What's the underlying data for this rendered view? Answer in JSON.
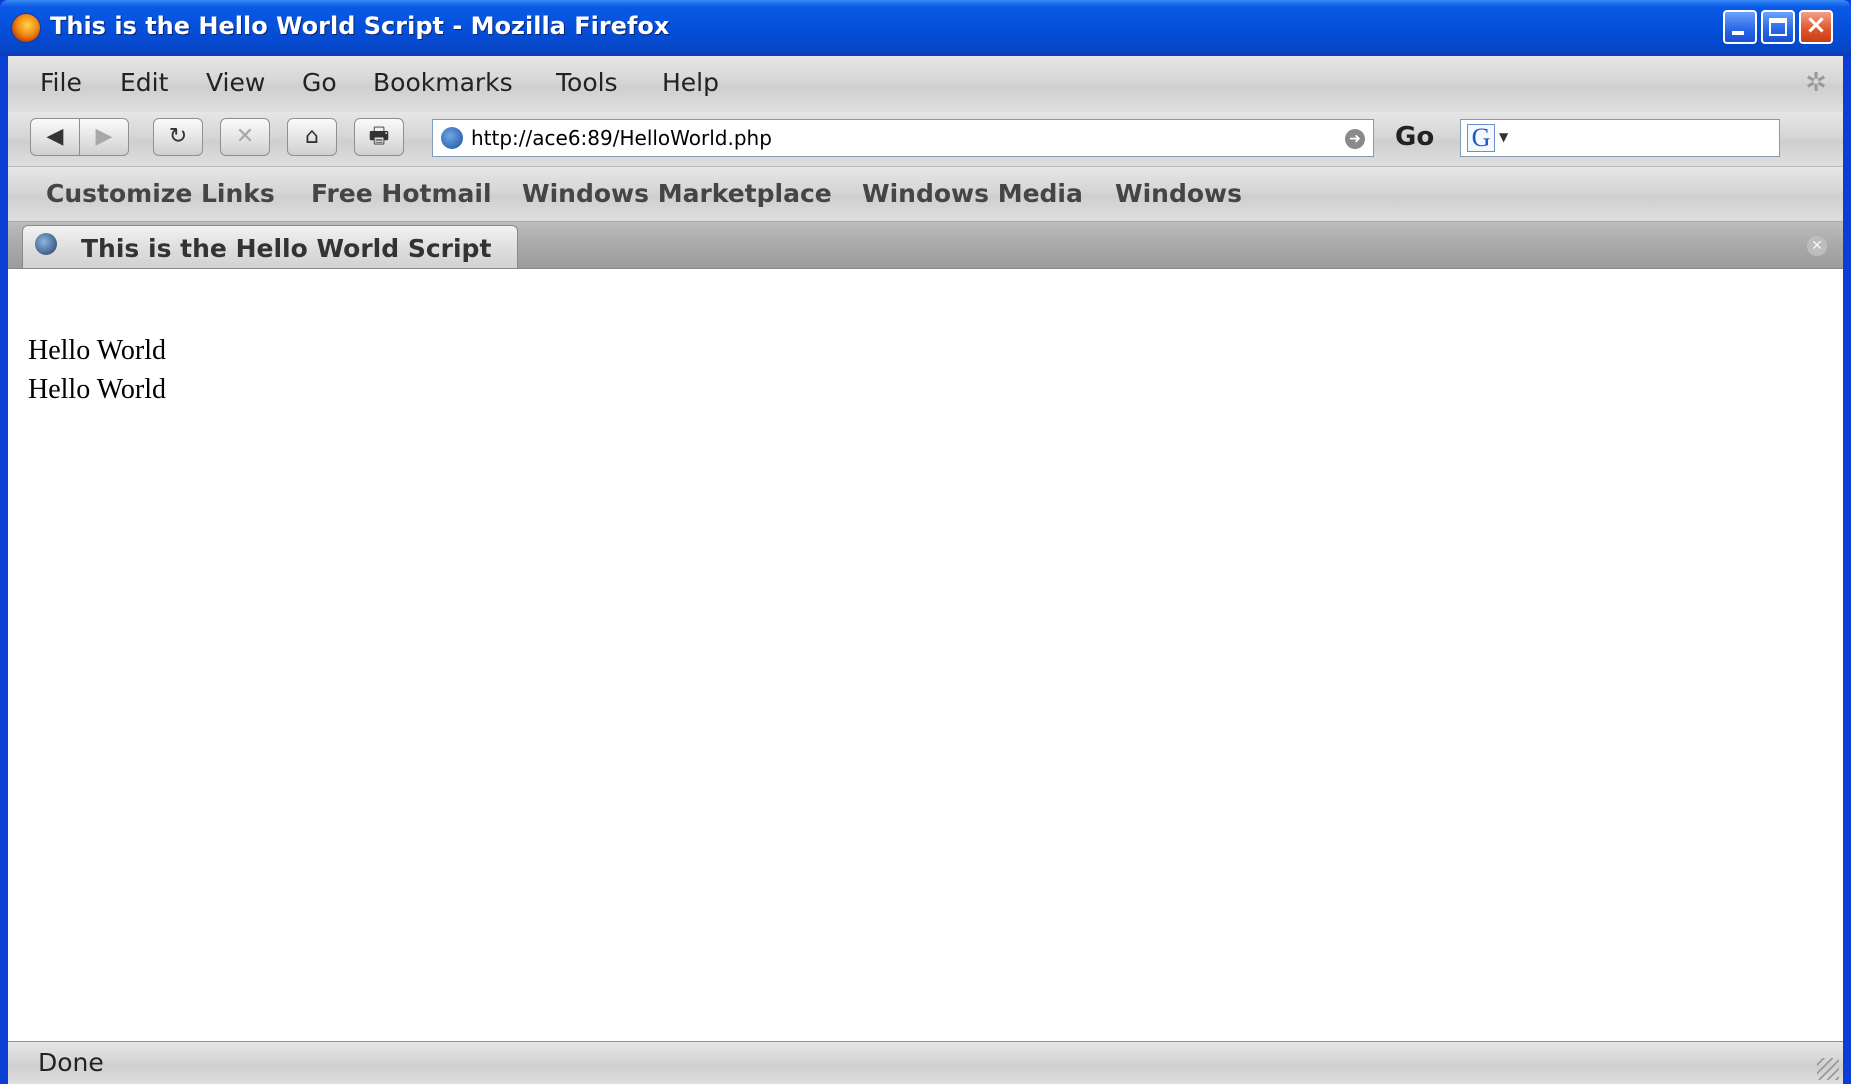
{
  "window": {
    "title": "This is the Hello World Script - Mozilla Firefox",
    "controls": [
      "minimize",
      "maximize",
      "close"
    ]
  },
  "menu": {
    "items": [
      "File",
      "Edit",
      "View",
      "Go",
      "Bookmarks",
      "Tools",
      "Help"
    ]
  },
  "toolbar": {
    "back_icon": "◀",
    "forward_icon": "▶",
    "reload_icon": "↻",
    "stop_icon": "✕",
    "home_icon": "⌂",
    "print_icon": "🖶",
    "go_label": "Go",
    "search_engine_letter": "G"
  },
  "urlbar": {
    "value": "http://ace6:89/HelloWorld.php"
  },
  "bookmarks": [
    "Customize Links",
    "Free Hotmail",
    "Windows Marketplace",
    "Windows Media",
    "Windows"
  ],
  "tab": {
    "label": "This is the Hello World Script",
    "close_icon": "✕"
  },
  "content": {
    "lines": [
      "Hello World",
      "Hello World"
    ]
  },
  "status": {
    "text": "Done"
  }
}
